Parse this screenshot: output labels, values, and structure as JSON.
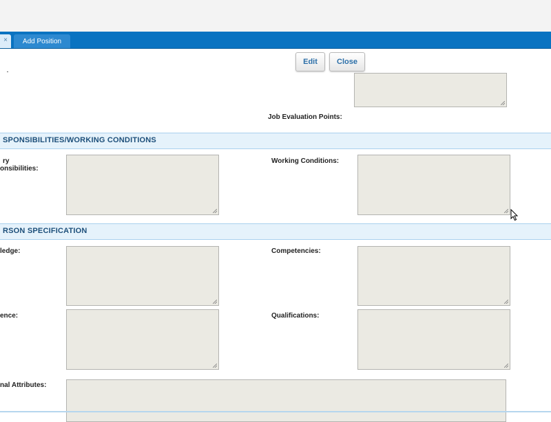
{
  "tabs": {
    "prev_close": "×",
    "active_label": "Add Position"
  },
  "toolbar": {
    "edit_label": "Edit",
    "close_label": "Close"
  },
  "fields": {
    "job_evaluation_points_label": "Job Evaluation Points:",
    "primary_responsibilities_label_line1": "ry",
    "primary_responsibilities_label_line2": "onsibilities:",
    "working_conditions_label": "Working Conditions:",
    "knowledge_label": "ledge:",
    "competencies_label": "Competencies:",
    "experience_label": "ence:",
    "qualifications_label": "Qualifications:",
    "personal_attributes_label": "nal Attributes:"
  },
  "sections": {
    "responsibilities_title": "SPONSIBILITIES/WORKING CONDITIONS",
    "person_spec_title": "RSON SPECIFICATION"
  },
  "colors": {
    "tabstrip": "#0a73c1",
    "section_bg": "#e5f2fb",
    "section_text": "#1d4f7a",
    "textarea_bg": "#ebeae3",
    "button_text": "#2c6fa8"
  }
}
